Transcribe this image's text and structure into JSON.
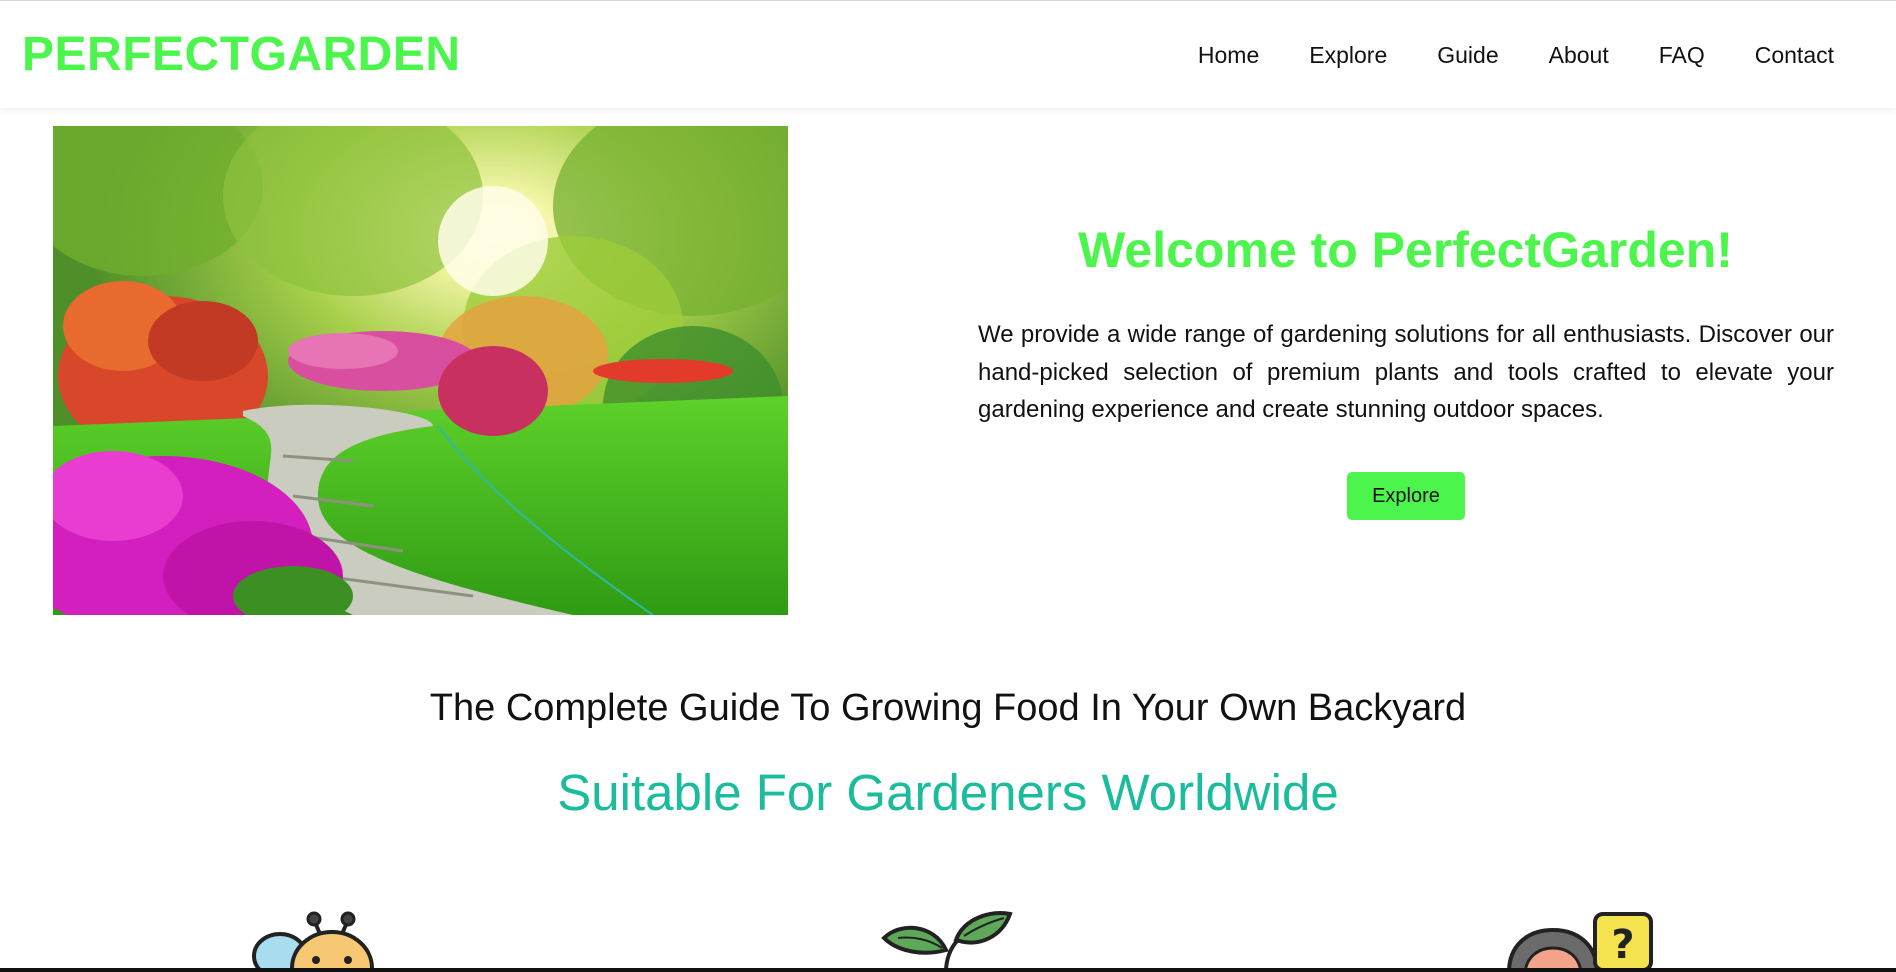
{
  "header": {
    "logo": "PERFECTGARDEN",
    "nav": [
      {
        "label": "Home"
      },
      {
        "label": "Explore"
      },
      {
        "label": "Guide"
      },
      {
        "label": "About"
      },
      {
        "label": "FAQ"
      },
      {
        "label": "Contact"
      }
    ]
  },
  "hero": {
    "title": "Welcome to PerfectGarden!",
    "text": "We provide a wide range of gardening solutions for all enthusiasts. Discover our hand-picked selection of premium plants and tools crafted to elevate your gardening experience and create stunning outdoor spaces.",
    "button_label": "Explore"
  },
  "guide": {
    "title": "The Complete Guide To Growing Food In Your Own Backyard",
    "subtitle": "Suitable For Gardeners Worldwide"
  },
  "colors": {
    "brand_green": "#4cf54c",
    "teal": "#1abc9c"
  },
  "icons": [
    "bee-icon",
    "leaf-sprout-icon",
    "question-person-icon"
  ]
}
